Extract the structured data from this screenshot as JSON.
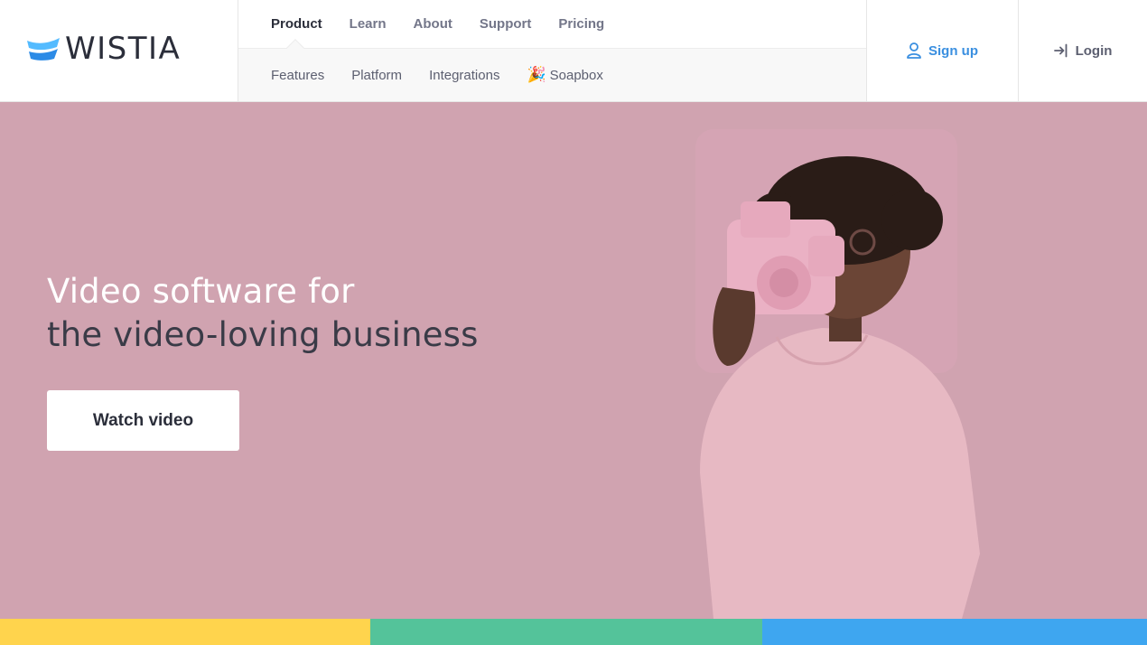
{
  "brand": {
    "name": "WISTIA"
  },
  "nav": {
    "primary": [
      "Product",
      "Learn",
      "About",
      "Support",
      "Pricing"
    ],
    "active": "Product",
    "secondary": [
      "Features",
      "Platform",
      "Integrations",
      "Soapbox"
    ],
    "secondary_icon": "party-popper-icon"
  },
  "account": {
    "signup_label": "Sign up",
    "login_label": "Login"
  },
  "hero": {
    "title_line1": "Video software for",
    "title_line2": "the video-loving business",
    "cta_label": "Watch video",
    "background_color": "#d0a3b0"
  },
  "colors": {
    "accent_blue": "#3a8fe0",
    "stripe_yellow": "#ffd44d",
    "stripe_green": "#54c39a",
    "stripe_blue": "#3ea6f0"
  }
}
